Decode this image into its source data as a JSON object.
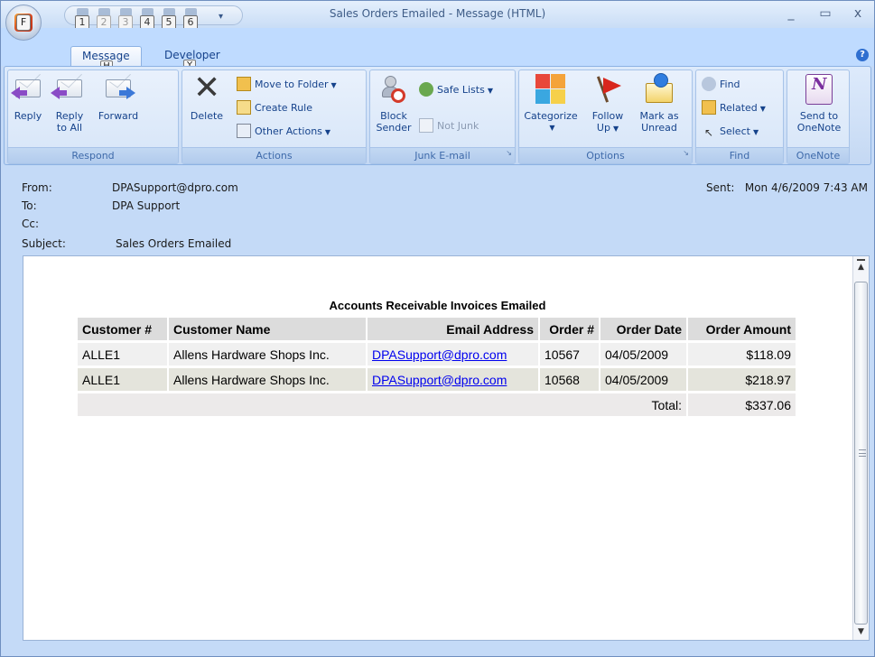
{
  "window": {
    "title": "Sales Orders Emailed - Message (HTML)",
    "office_keytip": "F",
    "minimize": "_",
    "maximize": "▭",
    "close": "x"
  },
  "qat": {
    "keytips": [
      "1",
      "2",
      "3",
      "4",
      "5",
      "6"
    ],
    "more": "⇧"
  },
  "tabs": [
    {
      "label": "Message",
      "keytip": "H"
    },
    {
      "label": "Developer",
      "keytip": "Y"
    }
  ],
  "ribbon": {
    "respond": {
      "label": "Respond",
      "reply": "Reply",
      "reply_all_1": "Reply",
      "reply_all_2": "to All",
      "forward": "Forward"
    },
    "actions": {
      "label": "Actions",
      "delete": "Delete",
      "move_to_folder": "Move to Folder",
      "create_rule": "Create Rule",
      "other_actions": "Other Actions"
    },
    "junk": {
      "label": "Junk E-mail",
      "block_1": "Block",
      "block_2": "Sender",
      "safe_lists": "Safe Lists",
      "not_junk": "Not Junk"
    },
    "options": {
      "label": "Options",
      "categorize": "Categorize",
      "follow_1": "Follow",
      "follow_2": "Up",
      "mark_1": "Mark as",
      "mark_2": "Unread"
    },
    "find": {
      "label": "Find",
      "find": "Find",
      "related": "Related",
      "select": "Select"
    },
    "onenote": {
      "label": "OneNote",
      "send_1": "Send to",
      "send_2": "OneNote"
    }
  },
  "header": {
    "from_label": "From:",
    "from_value": "DPASupport@dpro.com",
    "to_label": "To:",
    "to_value": "DPA Support",
    "cc_label": "Cc:",
    "cc_value": "",
    "subject_label": "Subject:",
    "subject_value": "Sales Orders Emailed",
    "sent_label": "Sent:",
    "sent_value": "Mon 4/6/2009 7:43 AM"
  },
  "report": {
    "title": "Accounts Receivable Invoices Emailed",
    "columns": [
      "Customer #",
      "Customer Name",
      "Email Address",
      "Order #",
      "Order Date",
      "Order Amount"
    ],
    "rows": [
      [
        "ALLE1",
        "Allens Hardware Shops Inc.",
        "DPASupport@dpro.com",
        "10567",
        "04/05/2009",
        "$118.09"
      ],
      [
        "ALLE1",
        "Allens Hardware Shops Inc.",
        "DPASupport@dpro.com",
        "10568",
        "04/05/2009",
        "$218.97"
      ]
    ],
    "total_label": "Total:",
    "total_value": "$337.06"
  }
}
